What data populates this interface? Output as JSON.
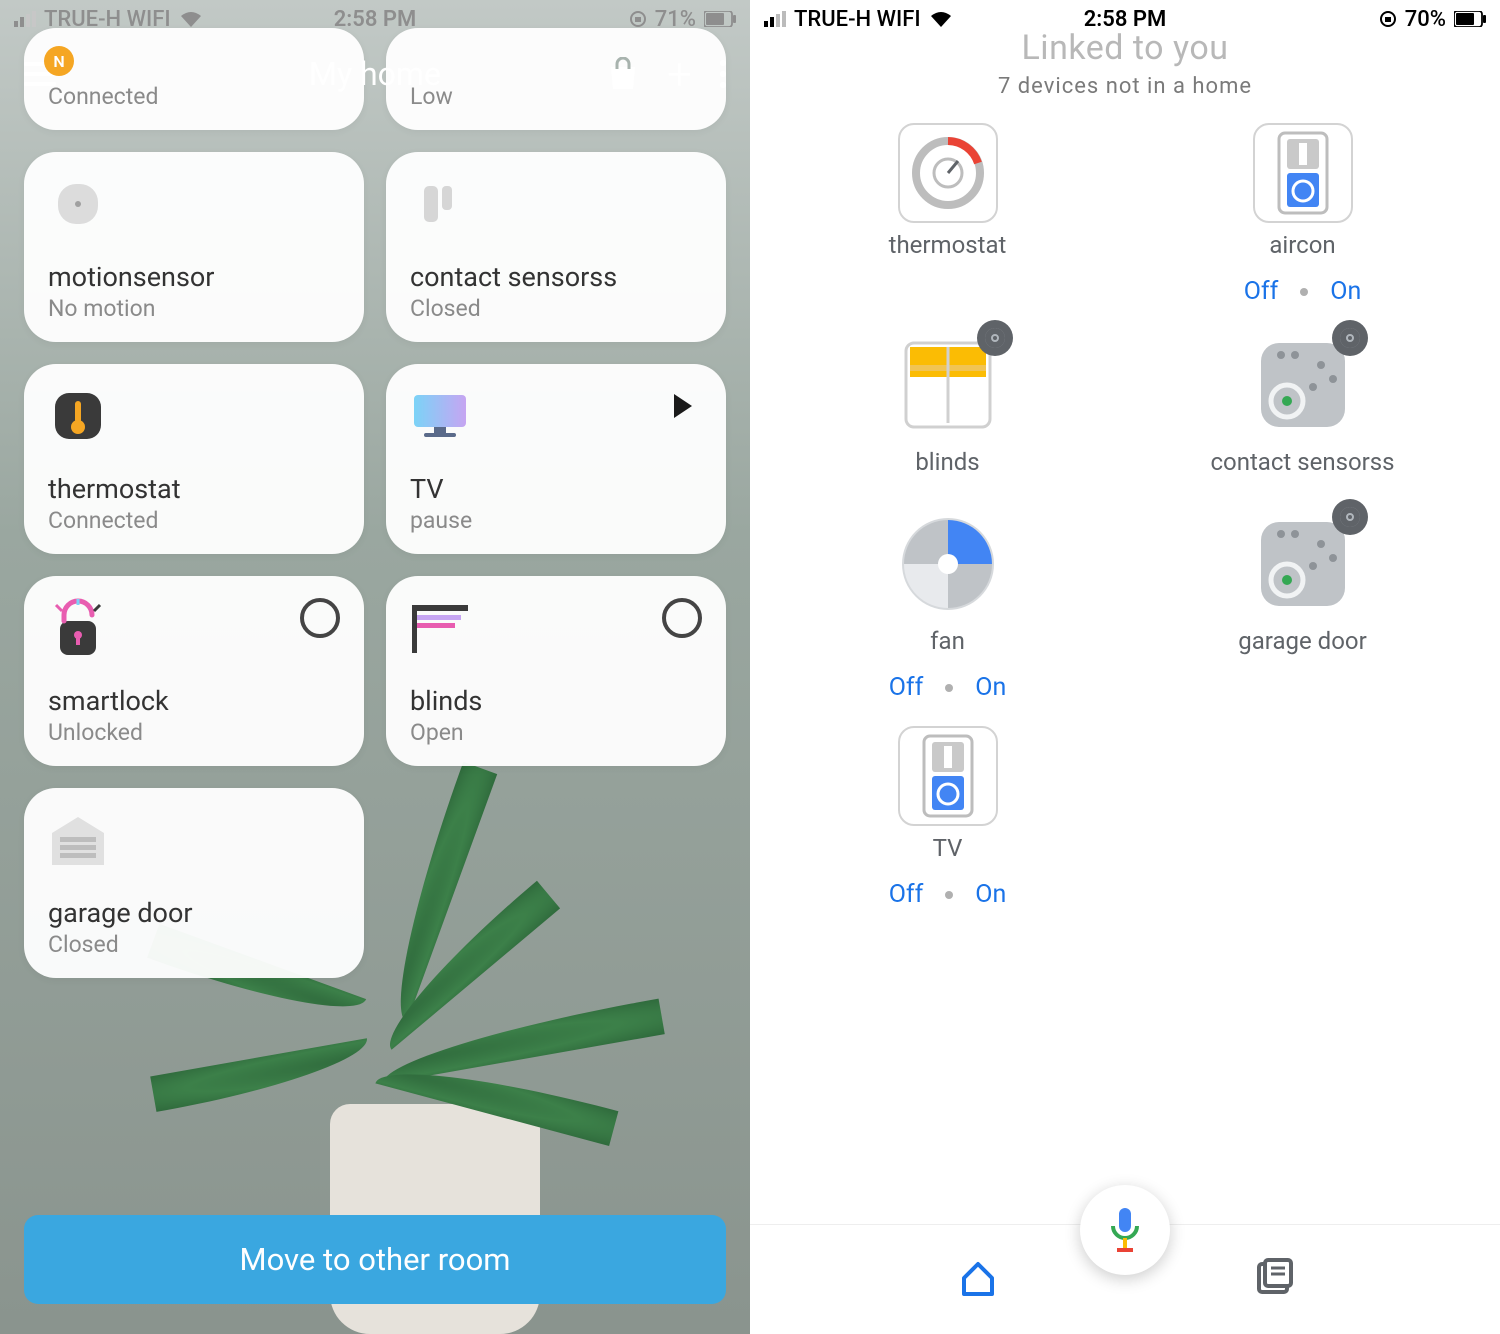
{
  "left": {
    "status": {
      "carrier": "TRUE-H WIFI",
      "time": "2:58 PM",
      "battery": "71%"
    },
    "header": {
      "badge": "N",
      "title": "My home"
    },
    "partial_tiles": [
      {
        "status": "Connected"
      },
      {
        "status": "Low"
      }
    ],
    "tiles": [
      {
        "title": "motionsensor",
        "status": "No motion",
        "icon": "motion"
      },
      {
        "title": "contact sensorss",
        "status": "Closed",
        "icon": "contact"
      },
      {
        "title": "thermostat",
        "status": "Connected",
        "icon": "thermostat"
      },
      {
        "title": "TV",
        "status": "pause",
        "icon": "tv",
        "action": "play"
      },
      {
        "title": "smartlock",
        "status": "Unlocked",
        "icon": "lock",
        "action": "ring"
      },
      {
        "title": "blinds",
        "status": "Open",
        "icon": "blinds",
        "action": "ring"
      },
      {
        "title": "garage door",
        "status": "Closed",
        "icon": "garage"
      }
    ],
    "move_button": "Move to other room"
  },
  "right": {
    "status": {
      "carrier": "TRUE-H WIFI",
      "time": "2:58 PM",
      "battery": "70%"
    },
    "title": "Linked to you",
    "subtitle": "7 devices not in a home",
    "devices": [
      {
        "label": "thermostat",
        "icon": "thermo",
        "border": true
      },
      {
        "label": "aircon",
        "icon": "ac",
        "border": true,
        "controls": true,
        "off": "Off",
        "on": "On"
      },
      {
        "label": "blinds",
        "icon": "blinds",
        "gear": true
      },
      {
        "label": "contact sensorss",
        "icon": "sensor",
        "gear": true
      },
      {
        "label": "fan",
        "icon": "fan",
        "controls": true,
        "off": "Off",
        "on": "On"
      },
      {
        "label": "garage door",
        "icon": "sensor",
        "gear": true
      },
      {
        "label": "TV",
        "icon": "ac",
        "border": true,
        "controls": true,
        "off": "Off",
        "on": "On"
      }
    ]
  }
}
